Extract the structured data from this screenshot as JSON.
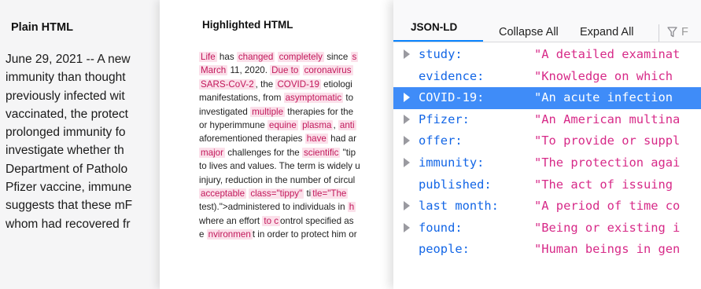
{
  "plain": {
    "title": "Plain HTML",
    "lines": [
      "June 29, 2021 -- A new",
      "immunity than thought",
      "previously infected wit",
      "vaccinated, the protect",
      "prolonged immunity fo",
      "investigate whether th",
      "Department of Patholo",
      "Pfizer vaccine, immune",
      "suggests that these mF",
      "whom had recovered fr"
    ]
  },
  "highlighted": {
    "title": "Highlighted HTML",
    "lines": [
      [
        {
          "t": "Life",
          "h": true
        },
        {
          "t": " has "
        },
        {
          "t": "changed",
          "h": true
        },
        {
          "t": " "
        },
        {
          "t": "completely",
          "h": true
        },
        {
          "t": " since "
        },
        {
          "t": "s",
          "h": true
        }
      ],
      [
        {
          "t": "March",
          "h": true
        },
        {
          "t": " 11, 2020. "
        },
        {
          "t": "Due to",
          "h": true
        },
        {
          "t": " "
        },
        {
          "t": "coronavirus",
          "h": true
        }
      ],
      [
        {
          "t": "SARS-CoV-2",
          "h": true
        },
        {
          "t": ", the "
        },
        {
          "t": "COVID-19",
          "h": true
        },
        {
          "t": " etiologi"
        }
      ],
      [
        {
          "t": "manifestations, from "
        },
        {
          "t": "asymptomatic",
          "h": true
        },
        {
          "t": " to"
        }
      ],
      [
        {
          "t": "investigated "
        },
        {
          "t": "multiple",
          "h": true
        },
        {
          "t": " therapies for the"
        }
      ],
      [
        {
          "t": "or hyperimmune "
        },
        {
          "t": "equine",
          "h": true
        },
        {
          "t": " "
        },
        {
          "t": "plasma",
          "h": true
        },
        {
          "t": ", "
        },
        {
          "t": "anti",
          "h": true
        }
      ],
      [
        {
          "t": "aforementioned therapies "
        },
        {
          "t": "have",
          "h": true
        },
        {
          "t": " had ar"
        }
      ],
      [
        {
          "t": "major",
          "h": true
        },
        {
          "t": " challenges for the "
        },
        {
          "t": "scientific",
          "h": true
        },
        {
          "t": " \"tip"
        }
      ],
      [
        {
          "t": "to lives and values. The term is widely u"
        }
      ],
      [
        {
          "t": "injury, reduction in the number of circul"
        }
      ],
      [
        {
          "t": "acceptable",
          "h": true
        },
        {
          "t": " "
        },
        {
          "t": "class=\"tippy\"",
          "h": true
        },
        {
          "t": " ti"
        },
        {
          "t": "tle=\"The",
          "h": true
        }
      ],
      [
        {
          "t": "test).\">administered to individuals in "
        },
        {
          "t": "h",
          "h": true
        }
      ],
      [
        {
          "t": "where an effort "
        },
        {
          "t": "to c",
          "h": true
        },
        {
          "t": "ontrol specified as"
        }
      ],
      [
        {
          "t": "e "
        },
        {
          "t": "nvironmen",
          "h": true
        },
        {
          "t": "t in order to protect him or"
        }
      ]
    ]
  },
  "json_viewer": {
    "tab_label": "JSON-LD",
    "collapse_all": "Collapse All",
    "expand_all": "Expand All",
    "filter_placeholder": "F",
    "rows": [
      {
        "key": "study:",
        "value": "\"A detailed examinat",
        "expandable": true,
        "selected": false
      },
      {
        "key": "evidence:",
        "value": "\"Knowledge on which ",
        "expandable": false,
        "selected": false
      },
      {
        "key": "COVID-19:",
        "value": "\"An acute infection ",
        "expandable": true,
        "selected": true
      },
      {
        "key": "Pfizer:",
        "value": "\"An American multina",
        "expandable": true,
        "selected": false
      },
      {
        "key": "offer:",
        "value": "\"To provide or suppl",
        "expandable": true,
        "selected": false
      },
      {
        "key": "immunity:",
        "value": "\"The protection agai",
        "expandable": true,
        "selected": false
      },
      {
        "key": "published:",
        "value": "\"The act of issuing ",
        "expandable": false,
        "selected": false
      },
      {
        "key": "last month:",
        "value": "\"A period of time co",
        "expandable": true,
        "selected": false
      },
      {
        "key": "found:",
        "value": "\"Being or existing i",
        "expandable": true,
        "selected": false
      },
      {
        "key": "people:",
        "value": "\"Human beings in gen",
        "expandable": false,
        "selected": false
      }
    ]
  },
  "colors": {
    "accent": "#0a84ff",
    "selected_row": "#3f8cf8",
    "json_key": "#1366e6",
    "json_string": "#d72a88",
    "highlight_text": "#c2185b",
    "highlight_bg": "#fbe0ea"
  },
  "icons": {
    "twisty": "triangle-right-icon",
    "filter": "filter-icon"
  }
}
